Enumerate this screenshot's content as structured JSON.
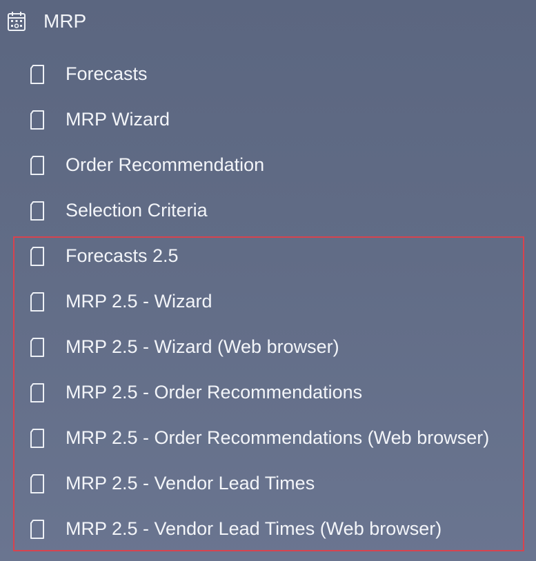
{
  "group": {
    "icon": "calendar-icon",
    "label": "MRP"
  },
  "items": [
    {
      "label": "Forecasts",
      "icon": "document-icon"
    },
    {
      "label": "MRP Wizard",
      "icon": "document-icon"
    },
    {
      "label": "Order Recommendation",
      "icon": "document-icon"
    },
    {
      "label": "Selection Criteria",
      "icon": "document-icon"
    },
    {
      "label": "Forecasts 2.5",
      "icon": "document-icon"
    },
    {
      "label": "MRP 2.5 - Wizard",
      "icon": "document-icon"
    },
    {
      "label": "MRP 2.5 - Wizard (Web browser)",
      "icon": "document-icon"
    },
    {
      "label": "MRP 2.5 - Order Recommendations",
      "icon": "document-icon"
    },
    {
      "label": "MRP 2.5 - Order Recommendations (Web browser)",
      "icon": "document-icon"
    },
    {
      "label": "MRP 2.5 - Vendor Lead Times",
      "icon": "document-icon"
    },
    {
      "label": "MRP 2.5 - Vendor Lead Times (Web browser)",
      "icon": "document-icon"
    }
  ],
  "colors": {
    "background": "#616c86",
    "text": "#f3f5f9",
    "highlight_border": "#d8434e"
  }
}
